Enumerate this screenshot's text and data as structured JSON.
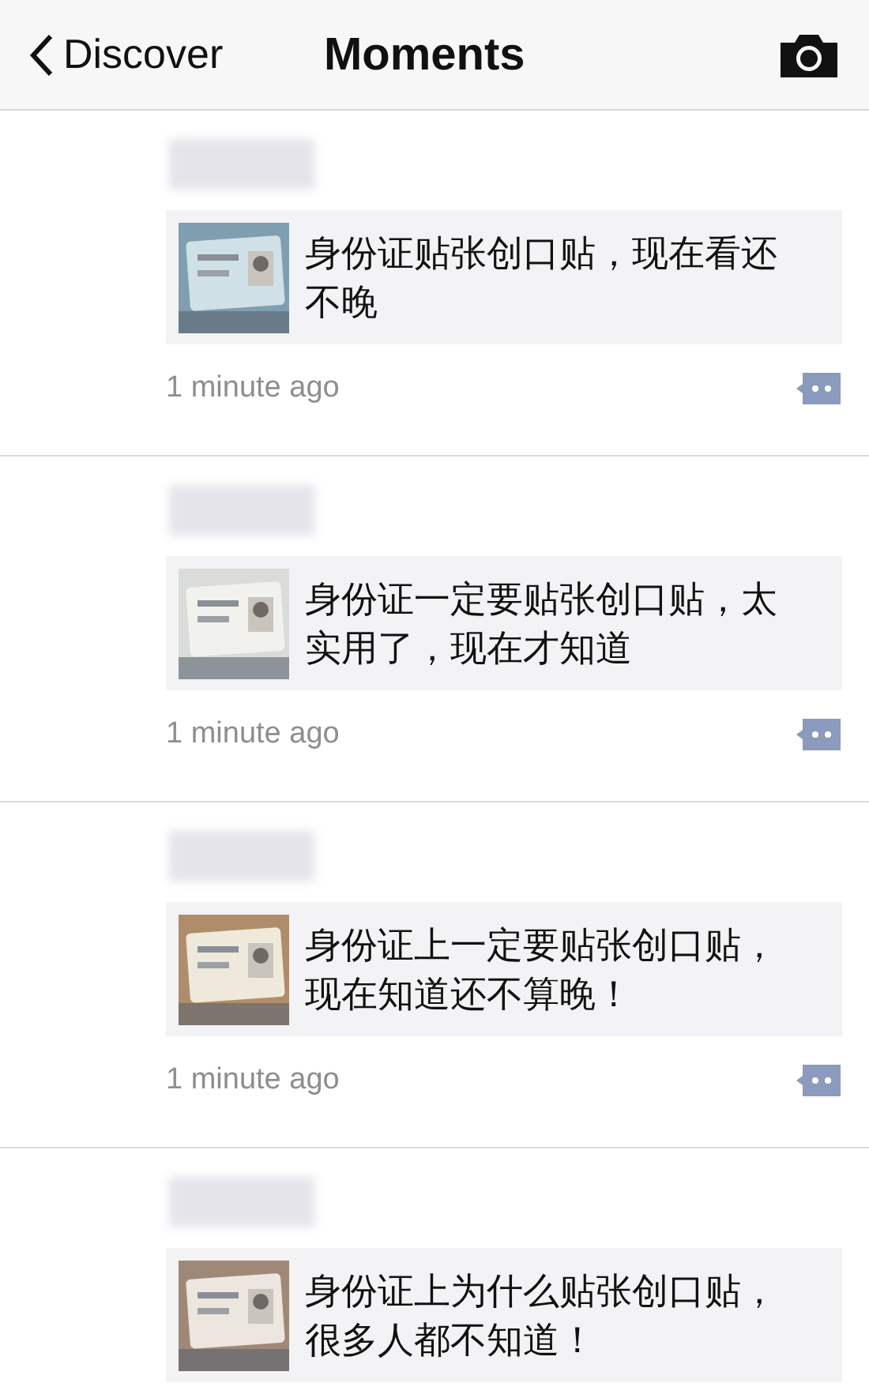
{
  "nav_bar": {
    "back_label": "Discover",
    "title": "Moments"
  },
  "posts": [
    {
      "link_text": "身份证贴张创口贴，现在看还不晚",
      "time": "1 minute ago"
    },
    {
      "link_text": "身份证一定要贴张创口贴，太实用了，现在才知道",
      "time": "1 minute ago"
    },
    {
      "link_text": "身份证上一定要贴张创口贴，现在知道还不算晚！",
      "time": "1 minute ago"
    },
    {
      "link_text": "身份证上为什么贴张创口贴，很多人都不知道！"
    }
  ]
}
